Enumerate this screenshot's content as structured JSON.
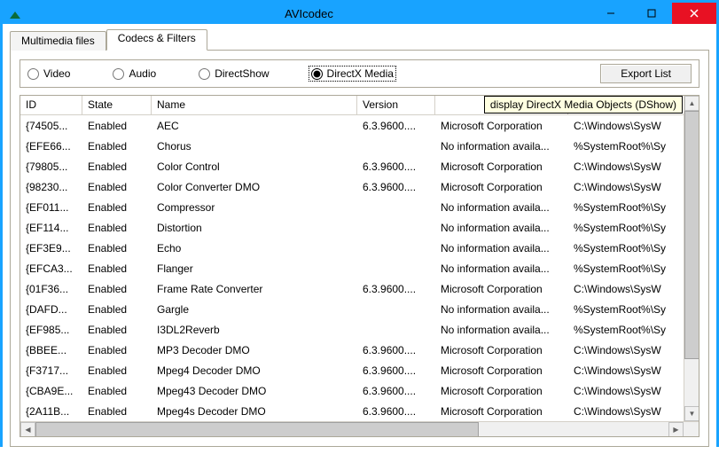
{
  "window": {
    "title": "AVIcodec"
  },
  "tabs": [
    {
      "label": "Multimedia files",
      "active": false
    },
    {
      "label": "Codecs & Filters",
      "active": true
    }
  ],
  "filters": {
    "options": [
      {
        "label": "Video",
        "checked": false
      },
      {
        "label": "Audio",
        "checked": false
      },
      {
        "label": "DirectShow",
        "checked": false
      },
      {
        "label": "DirectX Media",
        "checked": true
      }
    ],
    "export_label": "Export List"
  },
  "tooltip": "display DirectX Media Objects (DShow)",
  "columns": {
    "id": "ID",
    "state": "State",
    "name": "Name",
    "version": "Version",
    "company": "",
    "path": ""
  },
  "rows": [
    {
      "id": "{74505...",
      "state": "Enabled",
      "name": "AEC",
      "version": "6.3.9600....",
      "company": "Microsoft Corporation",
      "path": "C:\\Windows\\SysW"
    },
    {
      "id": "{EFE66...",
      "state": "Enabled",
      "name": "Chorus",
      "version": "",
      "company": "No information availa...",
      "path": "%SystemRoot%\\Sy"
    },
    {
      "id": "{79805...",
      "state": "Enabled",
      "name": "Color Control",
      "version": "6.3.9600....",
      "company": "Microsoft Corporation",
      "path": "C:\\Windows\\SysW"
    },
    {
      "id": "{98230...",
      "state": "Enabled",
      "name": "Color Converter DMO",
      "version": "6.3.9600....",
      "company": "Microsoft Corporation",
      "path": "C:\\Windows\\SysW"
    },
    {
      "id": "{EF011...",
      "state": "Enabled",
      "name": "Compressor",
      "version": "",
      "company": "No information availa...",
      "path": "%SystemRoot%\\Sy"
    },
    {
      "id": "{EF114...",
      "state": "Enabled",
      "name": "Distortion",
      "version": "",
      "company": "No information availa...",
      "path": "%SystemRoot%\\Sy"
    },
    {
      "id": "{EF3E9...",
      "state": "Enabled",
      "name": "Echo",
      "version": "",
      "company": "No information availa...",
      "path": "%SystemRoot%\\Sy"
    },
    {
      "id": "{EFCA3...",
      "state": "Enabled",
      "name": "Flanger",
      "version": "",
      "company": "No information availa...",
      "path": "%SystemRoot%\\Sy"
    },
    {
      "id": "{01F36...",
      "state": "Enabled",
      "name": "Frame Rate Converter",
      "version": "6.3.9600....",
      "company": "Microsoft Corporation",
      "path": "C:\\Windows\\SysW"
    },
    {
      "id": "{DAFD...",
      "state": "Enabled",
      "name": "Gargle",
      "version": "",
      "company": "No information availa...",
      "path": "%SystemRoot%\\Sy"
    },
    {
      "id": "{EF985...",
      "state": "Enabled",
      "name": "I3DL2Reverb",
      "version": "",
      "company": "No information availa...",
      "path": "%SystemRoot%\\Sy"
    },
    {
      "id": "{BBEE...",
      "state": "Enabled",
      "name": "MP3 Decoder DMO",
      "version": "6.3.9600....",
      "company": "Microsoft Corporation",
      "path": "C:\\Windows\\SysW"
    },
    {
      "id": "{F3717...",
      "state": "Enabled",
      "name": "Mpeg4 Decoder DMO",
      "version": "6.3.9600....",
      "company": "Microsoft Corporation",
      "path": "C:\\Windows\\SysW"
    },
    {
      "id": "{CBA9E...",
      "state": "Enabled",
      "name": "Mpeg43 Decoder DMO",
      "version": "6.3.9600....",
      "company": "Microsoft Corporation",
      "path": "C:\\Windows\\SysW"
    },
    {
      "id": "{2A11B...",
      "state": "Enabled",
      "name": "Mpeg4s Decoder DMO",
      "version": "6.3.9600....",
      "company": "Microsoft Corporation",
      "path": "C:\\Windows\\SysW"
    }
  ]
}
